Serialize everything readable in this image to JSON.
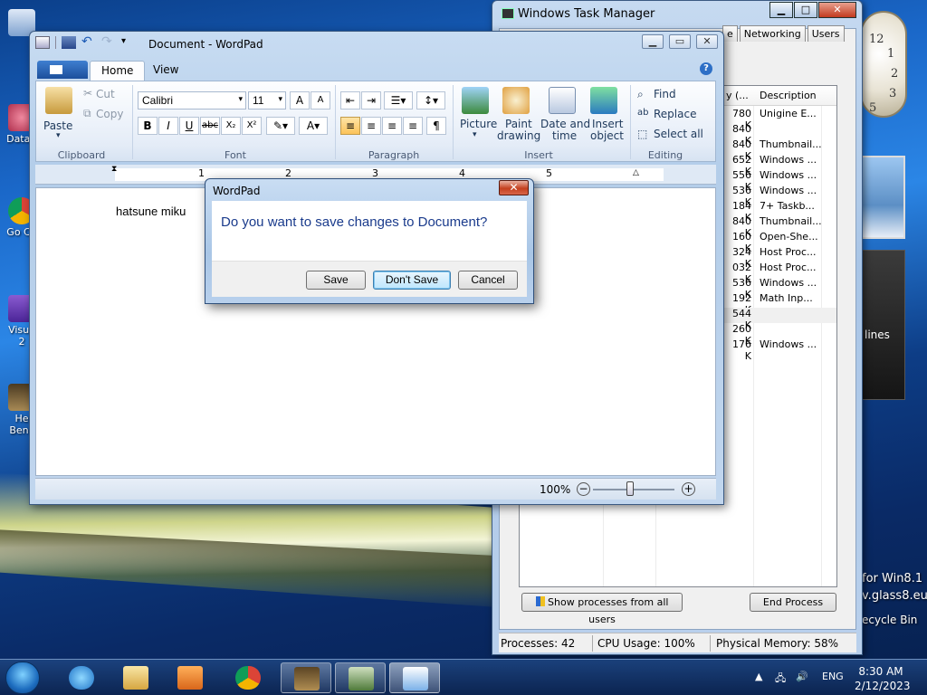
{
  "desktop": {
    "icons": [
      {
        "label": "DataV"
      },
      {
        "label": "Go Ch"
      },
      {
        "label": "Visua 2"
      },
      {
        "label": "He Benc"
      }
    ],
    "gadget_feed_text": "lines",
    "brand_line1": "for Win8.1",
    "brand_line2": "v.glass8.eu",
    "recycle_label": "ecycle Bin"
  },
  "task_manager": {
    "title": "Windows Task Manager",
    "tabs": [
      "Networking",
      "Users"
    ],
    "tab_fragment": "e",
    "columns": {
      "memory": "y (...",
      "description": "Description"
    },
    "rows": [
      {
        "mem": "780 K",
        "desc": "Unigine E..."
      },
      {
        "mem": "840 K",
        "desc": ""
      },
      {
        "mem": "840 K",
        "desc": "Thumbnail..."
      },
      {
        "mem": "652 K",
        "desc": "Windows ..."
      },
      {
        "mem": "556 K",
        "desc": "Windows ..."
      },
      {
        "mem": "536 K",
        "desc": "Windows ..."
      },
      {
        "mem": "184 K",
        "desc": "7+ Taskb..."
      },
      {
        "mem": "840 K",
        "desc": "Thumbnail..."
      },
      {
        "mem": "160 K",
        "desc": "Open-She..."
      },
      {
        "mem": "324 K",
        "desc": "Host Proc..."
      },
      {
        "mem": "032 K",
        "desc": "Host Proc..."
      },
      {
        "mem": "536 K",
        "desc": "Windows ..."
      },
      {
        "mem": "192 K",
        "desc": "Math Inp..."
      },
      {
        "mem": "544 K",
        "desc": ""
      },
      {
        "mem": "260 K",
        "desc": ""
      },
      {
        "mem": "176 K",
        "desc": "Windows ..."
      }
    ],
    "show_all_button": "Show processes from all users",
    "end_process_button": "End Process",
    "status": {
      "processes": "Processes: 42",
      "cpu": "CPU Usage: 100%",
      "memory": "Physical Memory: 58%"
    }
  },
  "wordpad": {
    "title": "Document - WordPad",
    "tabs": {
      "home": "Home",
      "view": "View"
    },
    "clipboard": {
      "paste": "Paste",
      "cut": "Cut",
      "copy": "Copy",
      "label": "Clipboard"
    },
    "font": {
      "family": "Calibri",
      "size": "11",
      "label": "Font"
    },
    "paragraph": {
      "label": "Paragraph"
    },
    "insert": {
      "picture": "Picture",
      "paint_1": "Paint",
      "paint_2": "drawing",
      "date_1": "Date and",
      "date_2": "time",
      "object_1": "Insert",
      "object_2": "object",
      "label": "Insert"
    },
    "editing": {
      "find": "Find",
      "replace": "Replace",
      "select_all": "Select all",
      "label": "Editing"
    },
    "ruler": [
      "1",
      "2",
      "3",
      "4",
      "5"
    ],
    "document_text": "hatsune miku",
    "zoom": "100%",
    "zoom_level": 0.45
  },
  "dialog": {
    "title": "WordPad",
    "message": "Do you want to save changes to Document?",
    "save": "Save",
    "dont_save": "Don't Save",
    "cancel": "Cancel"
  },
  "taskbar": {
    "language": "ENG",
    "time": "8:30 AM",
    "date": "2/12/2023"
  }
}
